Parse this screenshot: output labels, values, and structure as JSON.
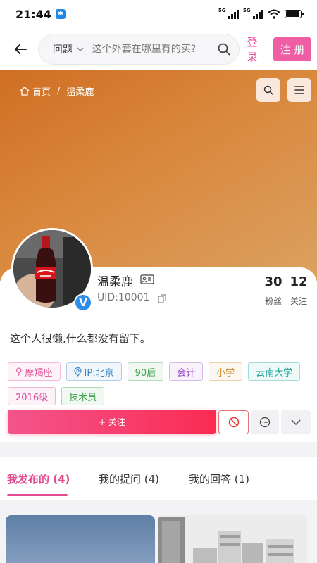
{
  "status_bar": {
    "time": "21:44",
    "bluetooth_icon": "bluetooth-icon",
    "signal_1": "5G",
    "signal_2": "5G",
    "battery_level": 0.95
  },
  "nav": {
    "search_type": "问题",
    "search_placeholder": "这个外套在哪里有的买?",
    "login_label": "登录",
    "register_label": "注 册"
  },
  "breadcrumb": {
    "home": "首页",
    "separator": "/",
    "current": "温柔鹿"
  },
  "profile": {
    "name": "温柔鹿",
    "uid": "UID:10001",
    "verified_badge": "V",
    "fans_count": "30",
    "fans_label": "粉丝",
    "following_count": "12",
    "following_label": "关注",
    "bio": "这个人很懒,什么都没有留下。",
    "tags": [
      {
        "label": "摩羯座",
        "icon": "female-icon",
        "color": "#e0559a"
      },
      {
        "label": "IP:北京",
        "icon": "location-icon",
        "color": "#3a86c8"
      },
      {
        "label": "90后",
        "color": "#3fa14a"
      },
      {
        "label": "会计",
        "color": "#9a4fc8"
      },
      {
        "label": "小学",
        "color": "#d08a2a"
      },
      {
        "label": "云南大学",
        "color": "#1aa5a0"
      },
      {
        "label": "2016级",
        "color": "#d6459a"
      },
      {
        "label": "技术员",
        "color": "#3fa14a"
      }
    ],
    "follow_label": "+ 关注"
  },
  "tabs": [
    {
      "label": "我发布的 (4)",
      "active": true
    },
    {
      "label": "我的提问 (4)",
      "active": false
    },
    {
      "label": "我的回答 (1)",
      "active": false
    }
  ],
  "colors": {
    "accent": "#e14c91",
    "banner": "#d6843a",
    "follow": "#f8365f"
  }
}
